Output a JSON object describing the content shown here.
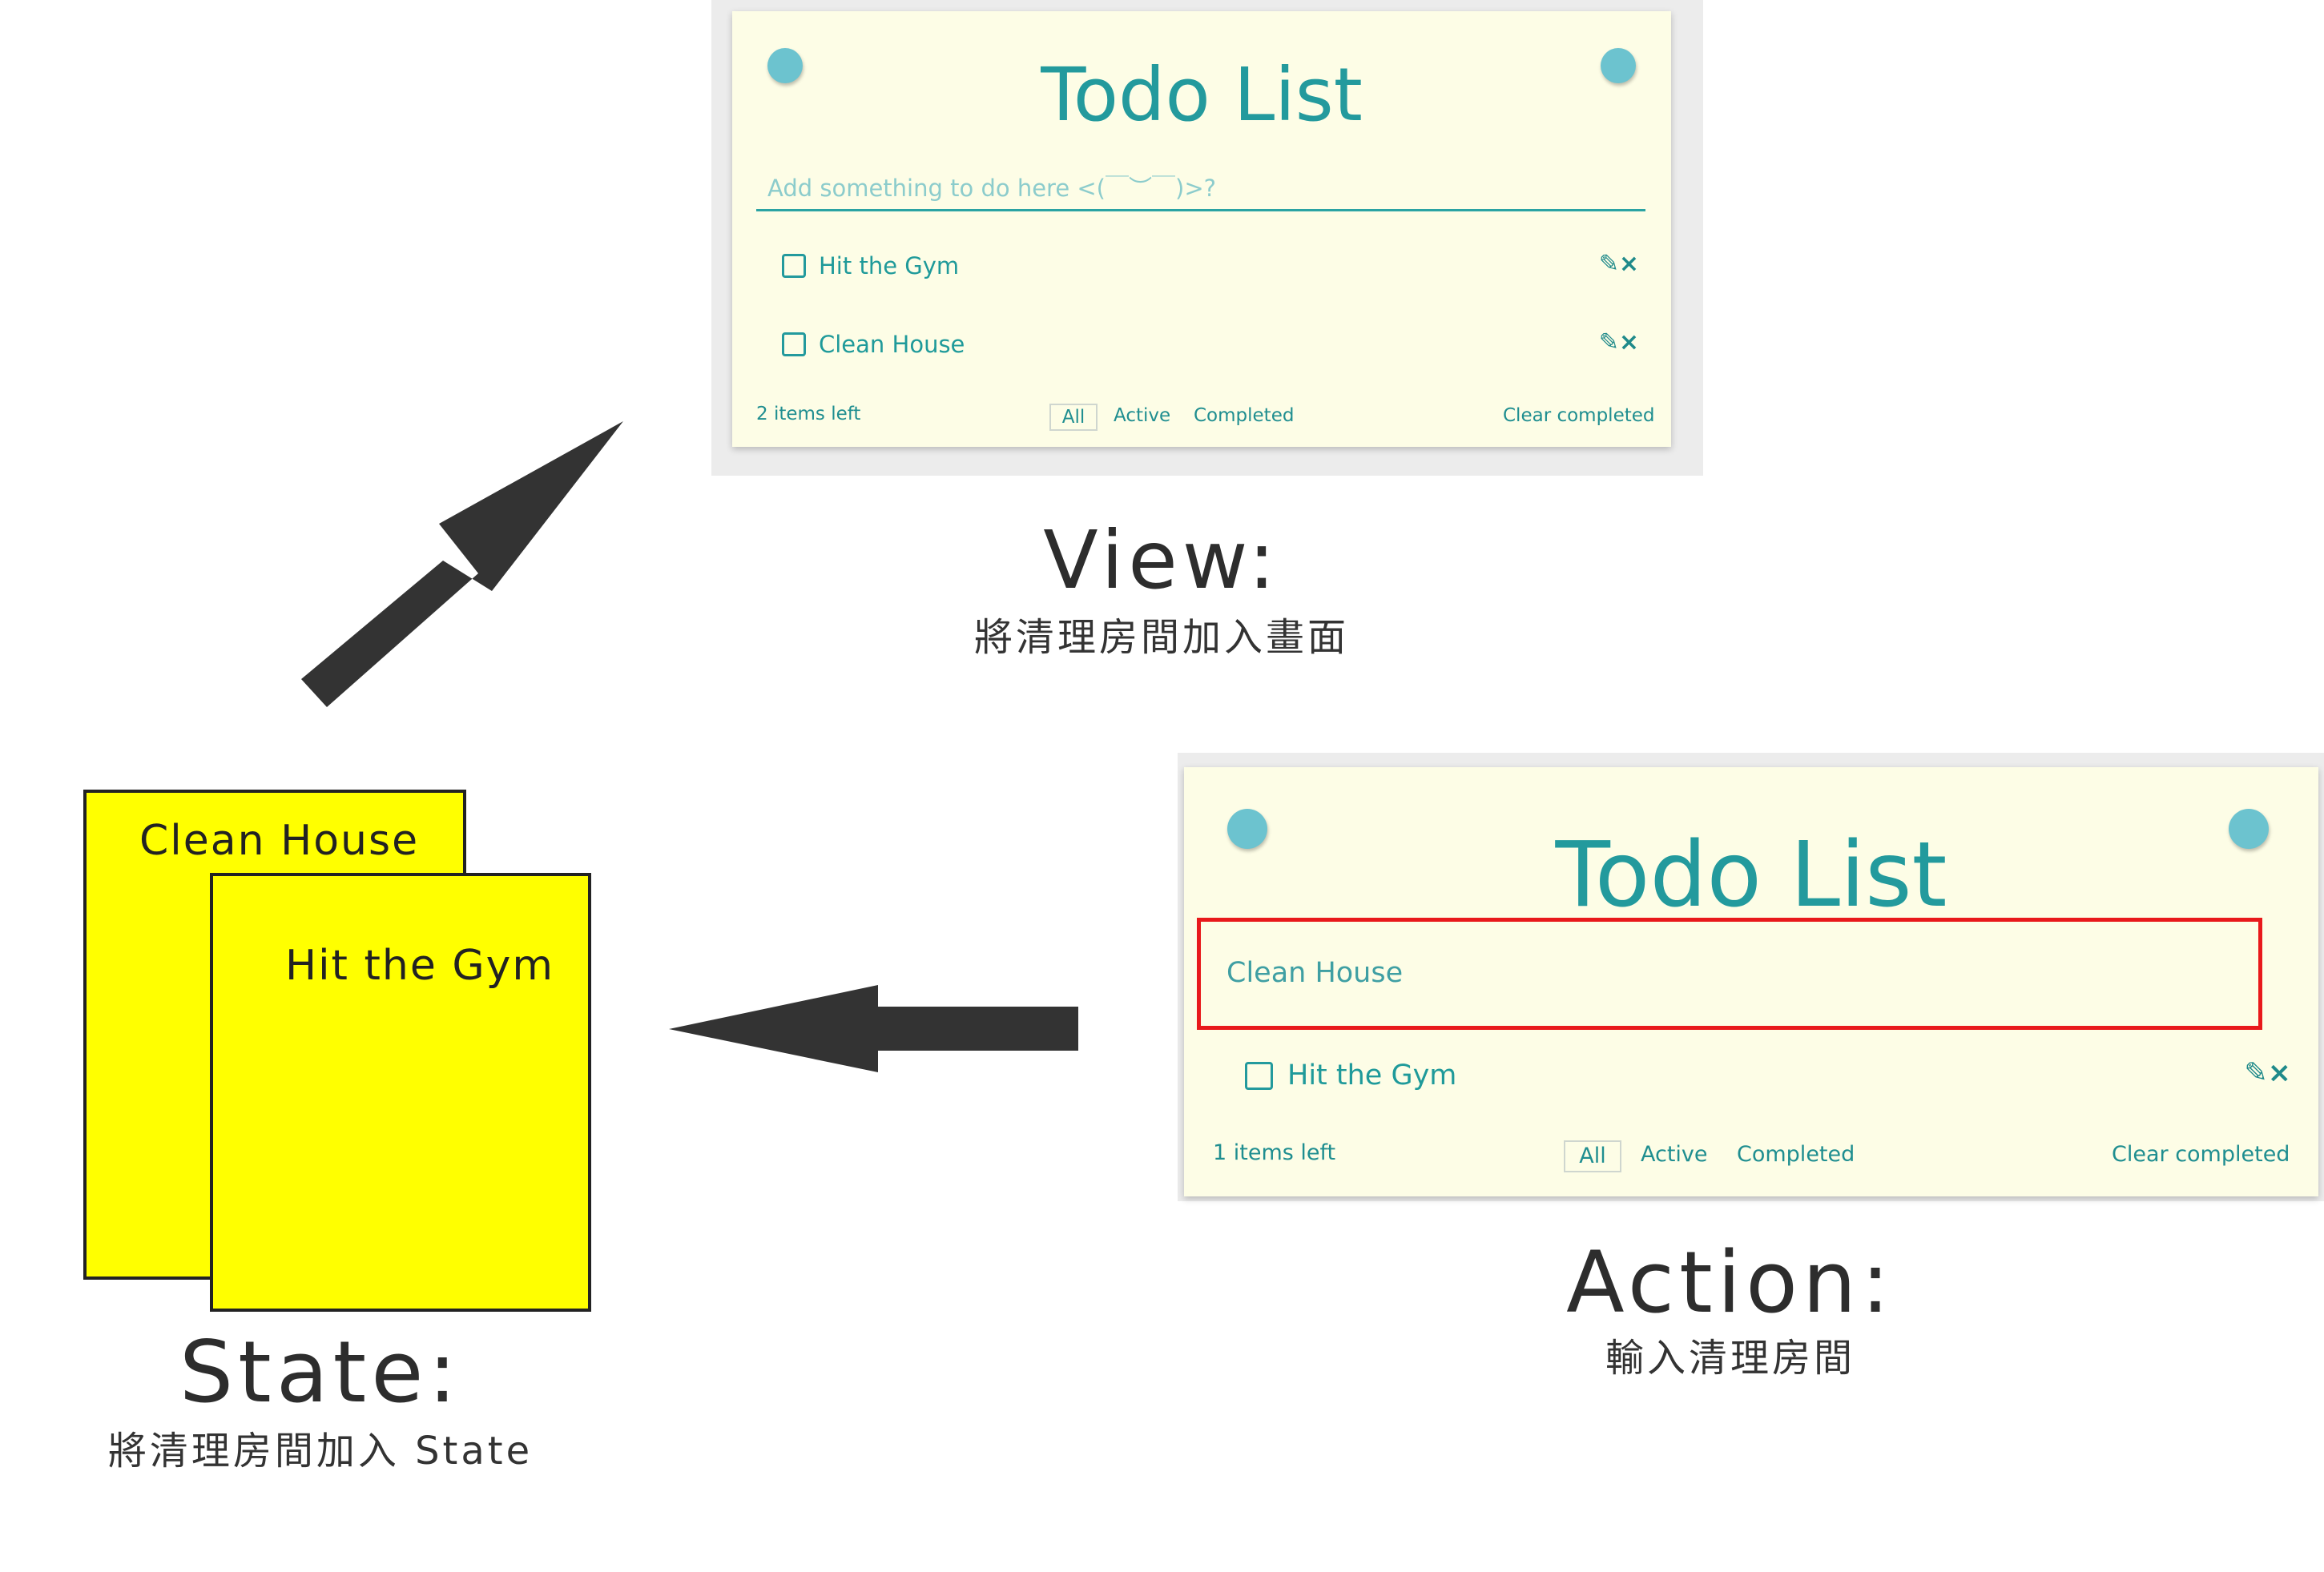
{
  "view_panel": {
    "title": "Todo List",
    "input_placeholder": "Add something to do here <(￣︶￣)>?",
    "items": [
      {
        "label": "Hit the Gym",
        "actions": "✎×"
      },
      {
        "label": "Clean House",
        "actions": "✎×"
      }
    ],
    "items_left": "2 items left",
    "filters": {
      "all": "All",
      "active": "Active",
      "completed": "Completed"
    },
    "clear_completed": "Clear completed"
  },
  "view_caption": {
    "title": "View:",
    "subtitle": "將清理房間加入畫面"
  },
  "action_panel": {
    "title": "Todo List",
    "input_value": "Clean House",
    "items": [
      {
        "label": "Hit the Gym",
        "actions": "✎×"
      }
    ],
    "items_left": "1 items left",
    "filters": {
      "all": "All",
      "active": "Active",
      "completed": "Completed"
    },
    "clear_completed": "Clear completed",
    "highlight_color": "#e8191b"
  },
  "action_caption": {
    "title": "Action:",
    "subtitle": "輸入清理房間"
  },
  "state": {
    "notes": [
      "Clean House",
      "Hit the Gym"
    ],
    "note_color": "#ffff00"
  },
  "state_caption": {
    "title": "State:",
    "subtitle": "將清理房間加入 State"
  },
  "arrow_color": "#333333"
}
